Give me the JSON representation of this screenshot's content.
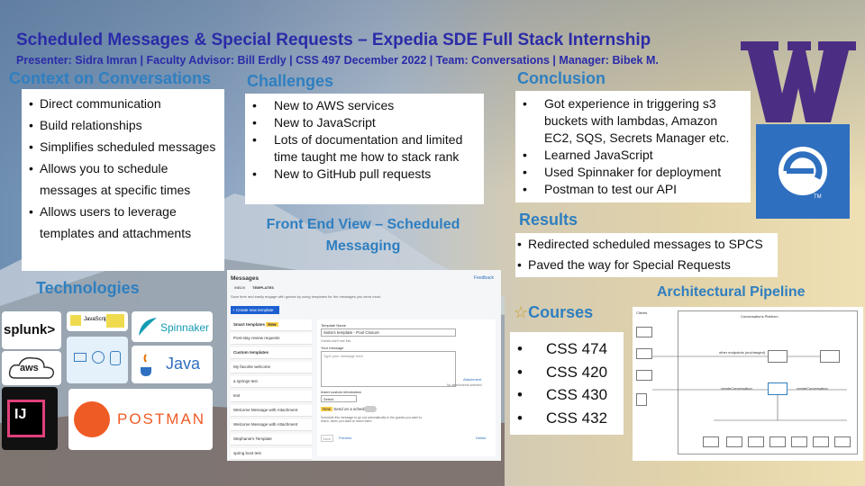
{
  "title": "Scheduled Messages & Special Requests – Expedia SDE Full Stack Internship",
  "subtitle": "Presenter: Sidra Imran | Faculty Advisor: Bill Erdly | CSS 497 December 2022 | Team: Conversations | Manager: Bibek M.",
  "context": {
    "heading": "Context on Conversations",
    "items": [
      "Direct communication",
      "Build relationships",
      "Simplifies scheduled messages",
      "Allows you to schedule messages at specific times",
      "Allows users to leverage templates and attachments"
    ]
  },
  "challenges": {
    "heading": "Challenges",
    "items": [
      "New to AWS services",
      "New to JavaScript",
      "Lots of documentation and limited time taught me how to stack rank",
      "New to GitHub pull requests"
    ]
  },
  "conclusion": {
    "heading": "Conclusion",
    "items": [
      "Got experience in triggering s3 buckets with lambdas, Amazon EC2, SQS, Secrets Manager etc.",
      "Learned JavaScript",
      "Used Spinnaker for deployment",
      "Postman to test our API"
    ]
  },
  "results": {
    "heading": "Results",
    "items": [
      "Redirected scheduled messages to SPCS",
      "Paved the way for Special Requests"
    ]
  },
  "technologies": {
    "heading": "Technologies",
    "logos": {
      "splunk": "splunk>",
      "javascript": "JavaScript",
      "spinnaker": "Spinnaker",
      "aws": "aws",
      "java": "Java",
      "intellij": "IJ",
      "postman": "POSTMAN"
    }
  },
  "frontend": {
    "heading": "Front End View – Scheduled Messaging",
    "screenshot": {
      "title": "Messages",
      "feedback": "Feedback",
      "tabs": [
        "INBOX",
        "TEMPLATES"
      ],
      "description": "Save time and easily engage with guests by using templates for the messages you send most.",
      "create_button": "+ Create new template",
      "smart_templates": "Smart templates",
      "new_badge": "New",
      "smart_items": [
        "Post-stay review requests"
      ],
      "custom_templates": "Custom templates",
      "custom_items": [
        "My favorite welcome",
        "a springs test",
        "test",
        "Welcome Message with Attachment",
        "Welcome Message with Attachment",
        "Stephanie's Template",
        "spring boot test"
      ],
      "template_name_label": "Template Name",
      "template_name_value": "Sidra's template - Pool Closure",
      "guests_note": "Guests won't see this.",
      "message_label": "Your message",
      "message_placeholder": "Type your message here",
      "attachment": "Attachment",
      "no_attachments": "No attachments selected",
      "insert_label": "Insert custom information",
      "select_value": "Select",
      "new_badge2": "New",
      "send_schedule": "Send on a schedule",
      "schedule_desc": "Schedule this message to go out automatically to the guests you want to reach, when you want to reach them.",
      "save": "Save",
      "preview": "Preview",
      "delete": "Delete"
    }
  },
  "architecture": {
    "heading": "Architectural Pipeline",
    "clients": "Clients",
    "platform": "Conversations Platform",
    "labels": [
      "other endpoints (unchanged)",
      "createConversation",
      "createConversation"
    ]
  },
  "courses": {
    "heading": "Courses",
    "items": [
      "CSS 474",
      "CSS 420",
      "CSS 430",
      "CSS 432"
    ]
  },
  "colors": {
    "title": "#2b2ba8",
    "heading": "#2f7fc0",
    "uw_purple": "#4b2e83",
    "expedia_blue": "#2f6fbf"
  }
}
